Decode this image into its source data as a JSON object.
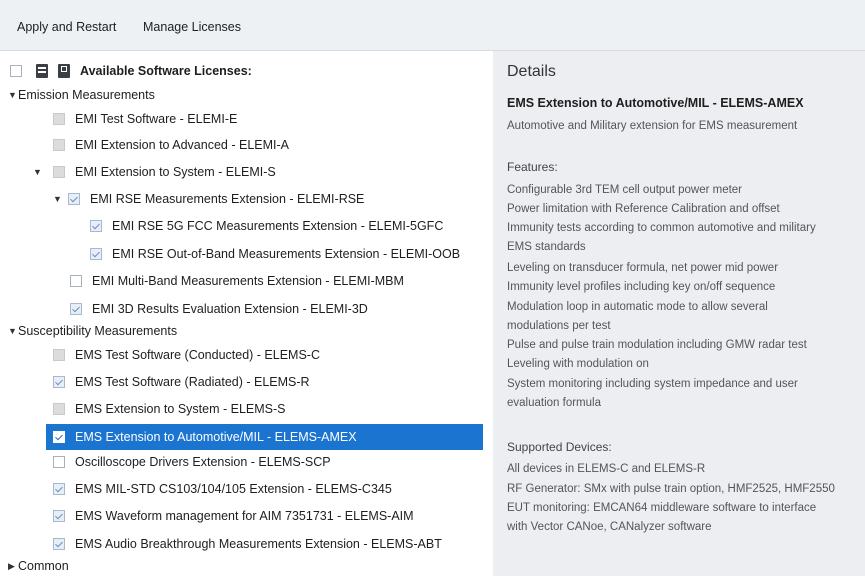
{
  "toolbar": {
    "apply_label": "Apply and Restart",
    "manage_label": "Manage Licenses"
  },
  "tree": {
    "header": "Available Software Licenses:",
    "groups": [
      {
        "label": "Emission Measurements"
      },
      {
        "label": "Susceptibility Measurements"
      },
      {
        "label": "Common"
      }
    ],
    "items": [
      {
        "label": "EMI Test Software  -  ELEMI-E"
      },
      {
        "label": "EMI Extension to Advanced  -  ELEMI-A"
      },
      {
        "label": "EMI Extension to System  -  ELEMI-S"
      },
      {
        "label": "EMI RSE Measurements Extension  -  ELEMI-RSE"
      },
      {
        "label": "EMI RSE 5G FCC Measurements Extension  -  ELEMI-5GFC"
      },
      {
        "label": "EMI RSE Out-of-Band Measurements Extension  -  ELEMI-OOB"
      },
      {
        "label": "EMI Multi-Band Measurements Extension  -  ELEMI-MBM"
      },
      {
        "label": "EMI 3D Results Evaluation Extension  -  ELEMI-3D"
      },
      {
        "label": "EMS Test Software (Conducted)  -  ELEMS-C"
      },
      {
        "label": "EMS Test Software (Radiated)  -  ELEMS-R"
      },
      {
        "label": "EMS Extension to System  -  ELEMS-S"
      },
      {
        "label": "EMS Extension to Automotive/MIL  -  ELEMS-AMEX"
      },
      {
        "label": "Oscilloscope Drivers Extension  -  ELEMS-SCP"
      },
      {
        "label": "EMS MIL-STD CS103/104/105 Extension  -  ELEMS-C345"
      },
      {
        "label": "EMS Waveform management for AIM 7351731  -  ELEMS-AIM"
      },
      {
        "label": "EMS Audio Breakthrough Measurements Extension  -  ELEMS-ABT"
      }
    ]
  },
  "details": {
    "heading": "Details",
    "title": "EMS Extension to Automotive/MIL  -  ELEMS-AMEX",
    "description": "Automotive and Military extension for EMS measurement",
    "features_heading": "Features:",
    "features": [
      "Configurable 3rd TEM cell output power meter",
      "Power limitation with Reference Calibration and offset",
      "Immunity tests according to common automotive and military",
      "EMS standards",
      "Leveling on transducer formula, net power mid power",
      "Immunity level profiles including key on/off sequence",
      "Modulation loop in automatic mode to allow several",
      "modulations per test",
      "Pulse and pulse train modulation including GMW radar test",
      "Leveling with modulation on",
      "System monitoring including system impedance and user",
      "evaluation formula"
    ],
    "devices_heading": "Supported Devices:",
    "devices": [
      "All devices in ELEMS-C and ELEMS-R",
      "RF Generator: SMx with pulse train option, HMF2525, HMF2550",
      "EUT monitoring: EMCAN64 middleware software to interface",
      "with Vector CANoe, CANalyzer software"
    ]
  }
}
